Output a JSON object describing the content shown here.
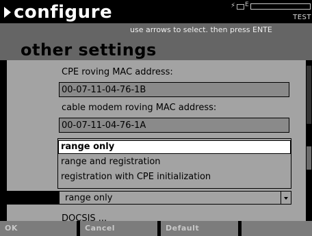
{
  "app": {
    "title": "configure",
    "mode_label": "TEST",
    "status_indicator_letter": "E"
  },
  "header": {
    "instruction": "use arrows to select. then press ENTE",
    "section_title": "other settings"
  },
  "fields": {
    "cpe_mac_label": "CPE roving MAC address:",
    "cpe_mac_value": "00-07-11-04-76-1B",
    "cm_mac_label": "cable modem roving MAC address:",
    "cm_mac_value": "00-07-11-04-76-1A"
  },
  "dropdown": {
    "options": [
      "range only",
      "range and registration",
      "registration with CPE initialization"
    ],
    "selected_index": 0,
    "current_value": "range only"
  },
  "next_label_partial": "DOCSIS ...",
  "softkeys": [
    "OK",
    "Cancel",
    "Default",
    ""
  ],
  "colors": {
    "background": "#000000",
    "header": "#656565",
    "content": "#a3a3a3",
    "field": "#8a8a8a",
    "softkey": "#7c7c7c",
    "selected_option": "#ffffff"
  },
  "icons": [
    "right-arrow-icon",
    "bolt-icon",
    "plug-icon",
    "battery-icon",
    "dropdown-arrow-icon"
  ]
}
